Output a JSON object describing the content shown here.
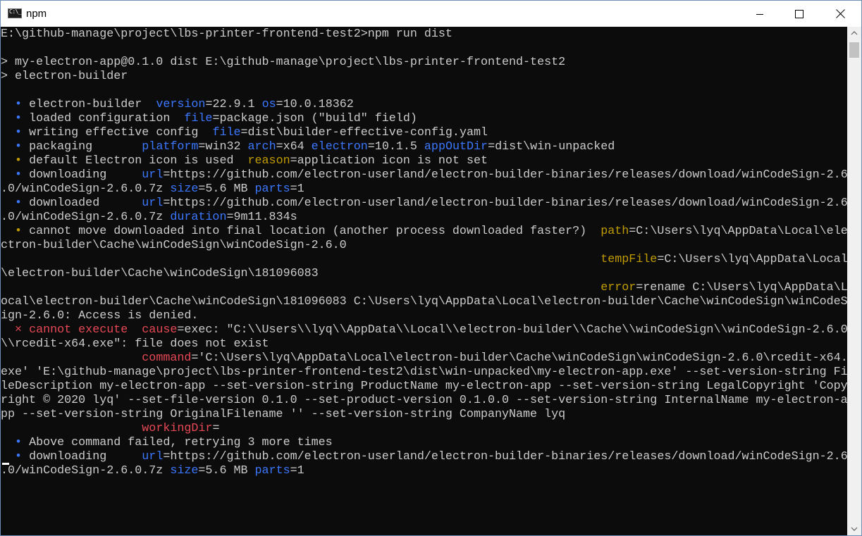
{
  "window": {
    "title": "npm",
    "icon_text": "C:\\_"
  },
  "controls": {
    "minimize": "minimize-icon",
    "maximize": "maximize-icon",
    "close": "close-icon"
  },
  "console": {
    "lines": [
      [
        [
          "E:\\github-manage\\project\\lbs-printer-frontend-test2>npm run dist",
          "gray"
        ]
      ],
      [],
      [
        [
          "> my-electron-app@0.1.0 dist E:\\github-manage\\project\\lbs-printer-frontend-test2",
          "gray"
        ]
      ],
      [
        [
          "> electron-builder",
          "gray"
        ]
      ],
      [],
      [
        [
          "  • ",
          "blue"
        ],
        [
          "electron-builder  ",
          "gray"
        ],
        [
          "version",
          "blue"
        ],
        [
          "=22.9.1 ",
          "gray"
        ],
        [
          "os",
          "blue"
        ],
        [
          "=10.0.18362",
          "gray"
        ]
      ],
      [
        [
          "  • ",
          "blue"
        ],
        [
          "loaded configuration  ",
          "gray"
        ],
        [
          "file",
          "blue"
        ],
        [
          "=package.json (\"build\" field)",
          "gray"
        ]
      ],
      [
        [
          "  • ",
          "blue"
        ],
        [
          "writing effective config  ",
          "gray"
        ],
        [
          "file",
          "blue"
        ],
        [
          "=dist\\builder-effective-config.yaml",
          "gray"
        ]
      ],
      [
        [
          "  • ",
          "blue"
        ],
        [
          "packaging       ",
          "gray"
        ],
        [
          "platform",
          "blue"
        ],
        [
          "=win32 ",
          "gray"
        ],
        [
          "arch",
          "blue"
        ],
        [
          "=x64 ",
          "gray"
        ],
        [
          "electron",
          "blue"
        ],
        [
          "=10.1.5 ",
          "gray"
        ],
        [
          "appOutDir",
          "blue"
        ],
        [
          "=dist\\win-unpacked",
          "gray"
        ]
      ],
      [
        [
          "  • ",
          "yellow"
        ],
        [
          "default Electron icon is used  ",
          "gray"
        ],
        [
          "reason",
          "yellow"
        ],
        [
          "=application icon is not set",
          "gray"
        ]
      ],
      [
        [
          "  • ",
          "blue"
        ],
        [
          "downloading     ",
          "gray"
        ],
        [
          "url",
          "blue"
        ],
        [
          "=https://github.com/electron-userland/electron-builder-binaries/releases/download/winCodeSign-2.6",
          "gray"
        ]
      ],
      [
        [
          ".0/winCodeSign-2.6.0.7z ",
          "gray"
        ],
        [
          "size",
          "blue"
        ],
        [
          "=5.6 MB ",
          "gray"
        ],
        [
          "parts",
          "blue"
        ],
        [
          "=1",
          "gray"
        ]
      ],
      [
        [
          "  • ",
          "blue"
        ],
        [
          "downloaded      ",
          "gray"
        ],
        [
          "url",
          "blue"
        ],
        [
          "=https://github.com/electron-userland/electron-builder-binaries/releases/download/winCodeSign-2.6",
          "gray"
        ]
      ],
      [
        [
          ".0/winCodeSign-2.6.0.7z ",
          "gray"
        ],
        [
          "duration",
          "blue"
        ],
        [
          "=9m11.834s",
          "gray"
        ]
      ],
      [
        [
          "  • ",
          "yellow"
        ],
        [
          "cannot move downloaded into final location (another process downloaded faster?)  ",
          "gray"
        ],
        [
          "path",
          "yellow"
        ],
        [
          "=C:\\Users\\lyq\\AppData\\Local\\ele",
          "gray"
        ]
      ],
      [
        [
          "ctron-builder\\Cache\\winCodeSign\\winCodeSign-2.6.0",
          "gray"
        ]
      ],
      [
        [
          "                                                                                     ",
          "gray"
        ],
        [
          "tempFile",
          "yellow"
        ],
        [
          "=C:\\Users\\lyq\\AppData\\Local",
          "gray"
        ]
      ],
      [
        [
          "\\electron-builder\\Cache\\winCodeSign\\181096083",
          "gray"
        ]
      ],
      [
        [
          "                                                                                     ",
          "gray"
        ],
        [
          "error",
          "yellow"
        ],
        [
          "=rename C:\\Users\\lyq\\AppData\\L",
          "gray"
        ]
      ],
      [
        [
          "ocal\\electron-builder\\Cache\\winCodeSign\\181096083 C:\\Users\\lyq\\AppData\\Local\\electron-builder\\Cache\\winCodeSign\\winCodeS",
          "gray"
        ]
      ],
      [
        [
          "ign-2.6.0: Access is denied.",
          "gray"
        ]
      ],
      [
        [
          "  × ",
          "red"
        ],
        [
          "cannot execute  ",
          "red"
        ],
        [
          "cause",
          "red"
        ],
        [
          "=exec: \"C:\\\\Users\\\\lyq\\\\AppData\\\\Local\\\\electron-builder\\\\Cache\\\\winCodeSign\\\\winCodeSign-2.6.0",
          "gray"
        ]
      ],
      [
        [
          "\\\\rcedit-x64.exe\": file does not exist",
          "gray"
        ]
      ],
      [
        [
          "                    ",
          "gray"
        ],
        [
          "command",
          "red"
        ],
        [
          "='C:\\Users\\lyq\\AppData\\Local\\electron-builder\\Cache\\winCodeSign\\winCodeSign-2.6.0\\rcedit-x64.",
          "gray"
        ]
      ],
      [
        [
          "exe' 'E:\\github-manage\\project\\lbs-printer-frontend-test2\\dist\\win-unpacked\\my-electron-app.exe' --set-version-string Fi",
          "gray"
        ]
      ],
      [
        [
          "leDescription my-electron-app --set-version-string ProductName my-electron-app --set-version-string LegalCopyright 'Copy",
          "gray"
        ]
      ],
      [
        [
          "right © 2020 lyq' --set-file-version 0.1.0 --set-product-version 0.1.0.0 --set-version-string InternalName my-electron-a",
          "gray"
        ]
      ],
      [
        [
          "pp --set-version-string OriginalFilename '' --set-version-string CompanyName lyq",
          "gray"
        ]
      ],
      [
        [
          "                    ",
          "gray"
        ],
        [
          "workingDir",
          "red"
        ],
        [
          "=",
          "gray"
        ]
      ],
      [
        [
          "  • ",
          "blue"
        ],
        [
          "Above command failed, retrying 3 more times",
          "gray"
        ]
      ],
      [
        [
          "  • ",
          "blue"
        ],
        [
          "downloading     ",
          "gray"
        ],
        [
          "url",
          "blue"
        ],
        [
          "=https://github.com/electron-userland/electron-builder-binaries/releases/download/winCodeSign-2.6",
          "gray"
        ]
      ],
      [
        [
          ".0/winCodeSign-2.6.0.7z ",
          "gray"
        ],
        [
          "size",
          "blue"
        ],
        [
          "=5.6 MB ",
          "gray"
        ],
        [
          "parts",
          "blue"
        ],
        [
          "=1",
          "gray"
        ]
      ]
    ]
  },
  "scrollbar": {
    "up_icon": "scroll-up-arrow-icon",
    "down_icon": "scroll-down-arrow-icon"
  }
}
